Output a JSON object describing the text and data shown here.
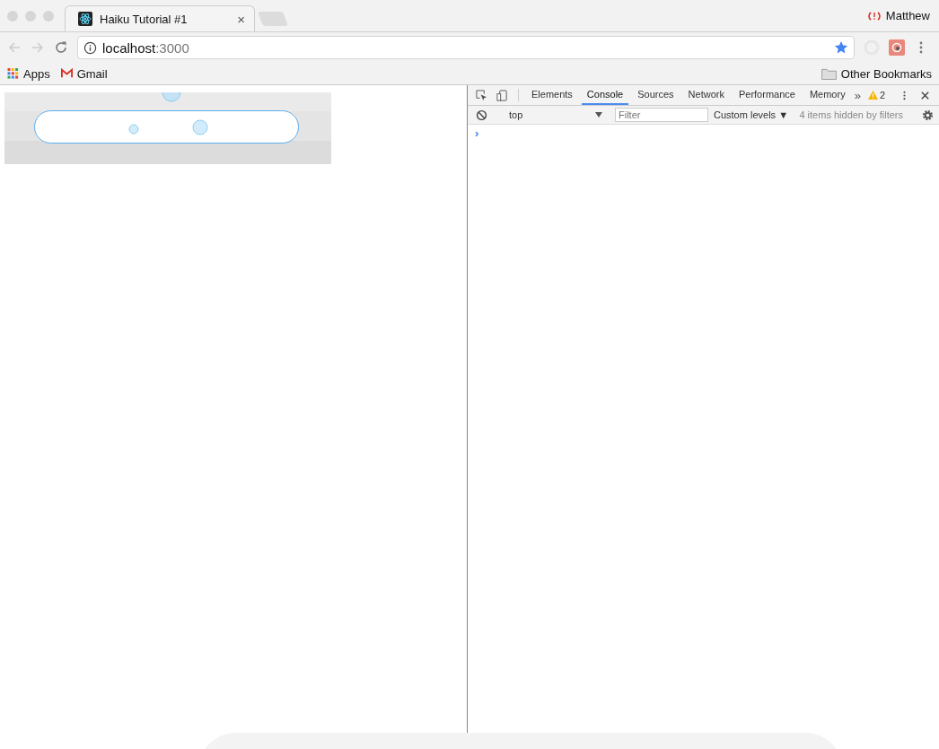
{
  "tabs": [
    {
      "title": "Haiku Tutorial #1",
      "close": "×",
      "selected": true
    }
  ],
  "profile": {
    "name": "Matthew"
  },
  "address": {
    "host": "localhost",
    "port": ":3000"
  },
  "bookmarks": [
    {
      "label": "Apps",
      "kind": "apps"
    },
    {
      "label": "Gmail",
      "kind": "gmail"
    }
  ],
  "other_bookmarks": "Other Bookmarks",
  "devtools": {
    "tabs": [
      {
        "label": "Elements",
        "selected": false
      },
      {
        "label": "Console",
        "selected": true
      },
      {
        "label": "Sources",
        "selected": false
      },
      {
        "label": "Network",
        "selected": false
      },
      {
        "label": "Performance",
        "selected": false
      },
      {
        "label": "Memory",
        "selected": false
      }
    ],
    "more": "»",
    "warnings": "2",
    "context": "top",
    "filter_placeholder": "Filter",
    "levels": "Custom levels ▼",
    "hidden_note": "4 items hidden by filters",
    "prompt": "›"
  }
}
